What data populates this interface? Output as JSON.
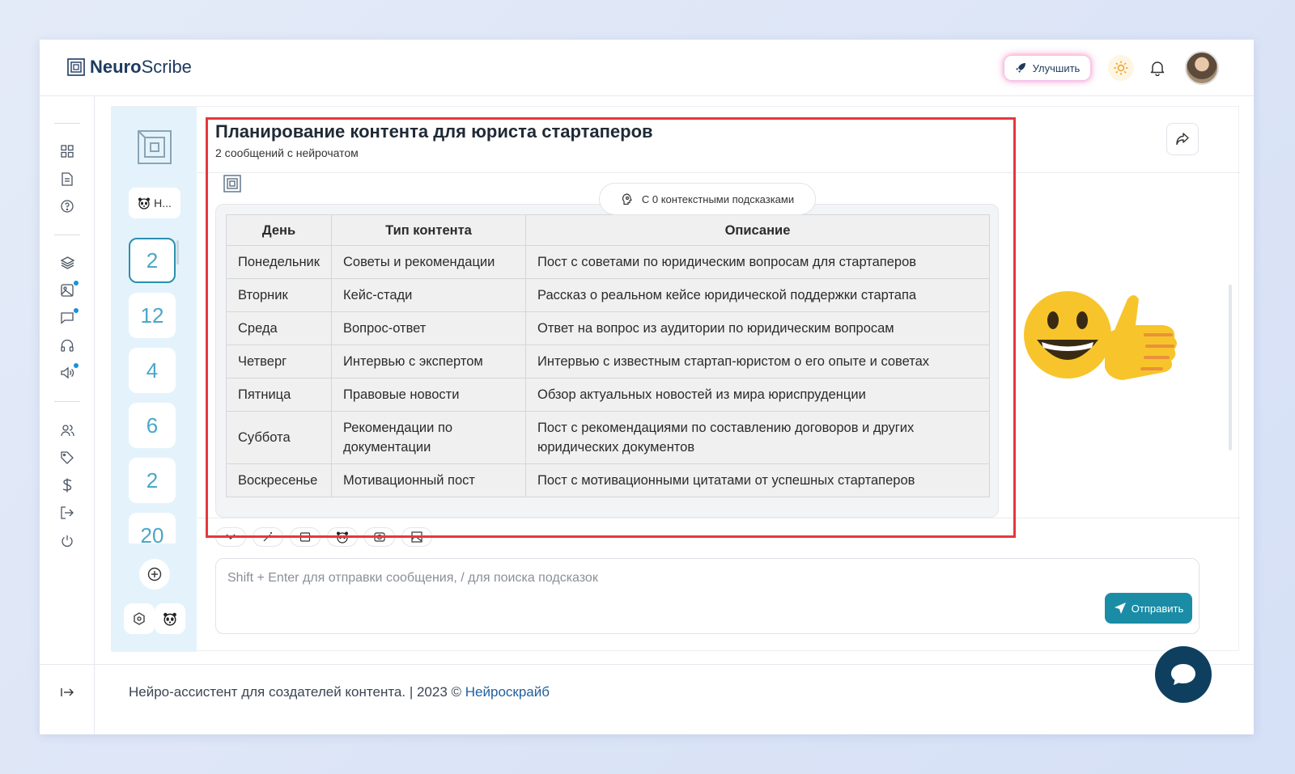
{
  "app": {
    "logo_prefix": "Neuro",
    "logo_suffix": "Scribe",
    "upgrade_label": "Улучшить"
  },
  "sidebar": {
    "icons": [
      "grid-icon",
      "document-icon",
      "help-icon",
      "layers-icon",
      "image-icon",
      "chat-icon",
      "headphones-icon",
      "megaphone-icon",
      "users-icon",
      "tag-icon",
      "dollar-icon",
      "logout-icon",
      "power-icon"
    ]
  },
  "chatlist": {
    "chip_label": "Н...",
    "counts": [
      "2",
      "12",
      "4",
      "6",
      "2",
      "20"
    ],
    "active_index": 0
  },
  "chat": {
    "title": "Планирование контента для юриста стартаперов",
    "subtitle": "2 сообщений с нейрочатом",
    "context_label": "С 0 контекстными подсказками",
    "table": {
      "headers": [
        "День",
        "Тип контента",
        "Описание"
      ],
      "rows": [
        [
          "Понедельник",
          "Советы и рекомендации",
          "Пост с советами по юридическим вопросам для стартаперов"
        ],
        [
          "Вторник",
          "Кейс-стади",
          "Рассказ о реальном кейсе юридической поддержки стартапа"
        ],
        [
          "Среда",
          "Вопрос-ответ",
          "Ответ на вопрос из аудитории по юридическим вопросам"
        ],
        [
          "Четверг",
          "Интервью с экспертом",
          "Интервью с известным стартап-юристом о его опыте и советах"
        ],
        [
          "Пятница",
          "Правовые новости",
          "Обзор актуальных новостей из мира юриспруденции"
        ],
        [
          "Суббота",
          "Рекомендации по документации",
          "Пост с рекомендациями по составлению договоров и других юридических документов"
        ],
        [
          "Воскресенье",
          "Мотивационный пост",
          "Пост с мотивационными цитатами от успешных стартаперов"
        ]
      ]
    },
    "input_placeholder": "Shift + Enter для отправки сообщения, / для поиска подсказок",
    "send_label": "Отправить"
  },
  "footer": {
    "text": "Нейро-ассистент для создателей контента.  | 2023 © ",
    "link": "Нейроскрайб"
  },
  "colors": {
    "accent": "#1a8ca6",
    "highlight": "#e5383b",
    "chat_bubble": "#0f3f5e"
  }
}
